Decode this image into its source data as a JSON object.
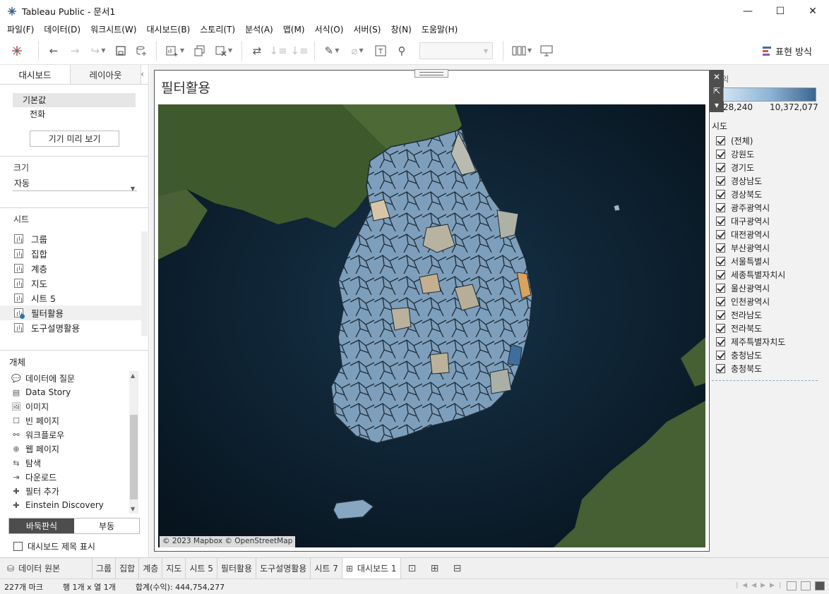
{
  "window": {
    "title": "Tableau Public - 문서1",
    "minimize": "—",
    "maximize": "☐",
    "close": "✕"
  },
  "menu": [
    "파일(F)",
    "데이터(D)",
    "워크시트(W)",
    "대시보드(B)",
    "스토리(T)",
    "분석(A)",
    "맵(M)",
    "서식(O)",
    "서버(S)",
    "창(N)",
    "도움말(H)"
  ],
  "toolbar": {
    "show_me_label": "표현 방식"
  },
  "left_pane": {
    "tabs": [
      "대시보드",
      "레이아웃"
    ],
    "collapse": "‹",
    "devices": [
      "기본값",
      "전화"
    ],
    "device_preview_button": "기기 미리 보기",
    "size_label": "크기",
    "size_value": "자동",
    "sheets_label": "시트",
    "sheets": [
      "그룹",
      "집합",
      "계층",
      "지도",
      "시트 5",
      "필터활용",
      "도구설명활용"
    ],
    "objects_label": "개체",
    "objects": [
      {
        "icon": "ask-data-icon",
        "glyph": "💬",
        "label": "데이터에 질문"
      },
      {
        "icon": "data-story-icon",
        "glyph": "▤",
        "label": "Data Story"
      },
      {
        "icon": "image-icon",
        "glyph": "🖼",
        "label": "이미지"
      },
      {
        "icon": "blank-icon",
        "glyph": "☐",
        "label": "빈 페이지"
      },
      {
        "icon": "workflow-icon",
        "glyph": "⚯",
        "label": "워크플로우"
      },
      {
        "icon": "web-page-icon",
        "glyph": "⊕",
        "label": "웹 페이지"
      },
      {
        "icon": "navigation-icon",
        "glyph": "⇆",
        "label": "탐색"
      },
      {
        "icon": "download-icon",
        "glyph": "⇥",
        "label": "다운로드"
      },
      {
        "icon": "extension-icon",
        "glyph": "✚",
        "label": "필터 추가"
      },
      {
        "icon": "einstein-icon",
        "glyph": "✚",
        "label": "Einstein Discovery"
      }
    ],
    "layout_options": [
      "바둑판식",
      "부동"
    ],
    "show_title_label": "대시보드 제목 표시"
  },
  "dashboard": {
    "title": "필터활용",
    "map_credit": "© 2023 Mapbox © OpenStreetMap",
    "floating_controls": [
      "✕",
      "⇱",
      "▾"
    ]
  },
  "legend": {
    "title": "익",
    "min": "28,240",
    "max": "10,372,077",
    "color_low": "#cfe3f3",
    "color_high": "#3c6690"
  },
  "filter": {
    "title": "시도",
    "items": [
      "(전체)",
      "강원도",
      "경기도",
      "경상남도",
      "경상북도",
      "광주광역시",
      "대구광역시",
      "대전광역시",
      "부산광역시",
      "서울특별시",
      "세종특별자치시",
      "울산광역시",
      "인천광역시",
      "전라남도",
      "전라북도",
      "제주특별자치도",
      "충청남도",
      "충청북도"
    ]
  },
  "bottom_tabs": {
    "data_source": "데이터 원본",
    "sheets": [
      "그룹",
      "집합",
      "계층",
      "지도",
      "시트 5",
      "필터활용",
      "도구설명활용",
      "시트 7"
    ],
    "active": "대시보드 1"
  },
  "status": {
    "marks": "227개 마크",
    "rows_cols": "행 1개  x  열 1개",
    "sum": "합계(수익): 444,754,277"
  }
}
